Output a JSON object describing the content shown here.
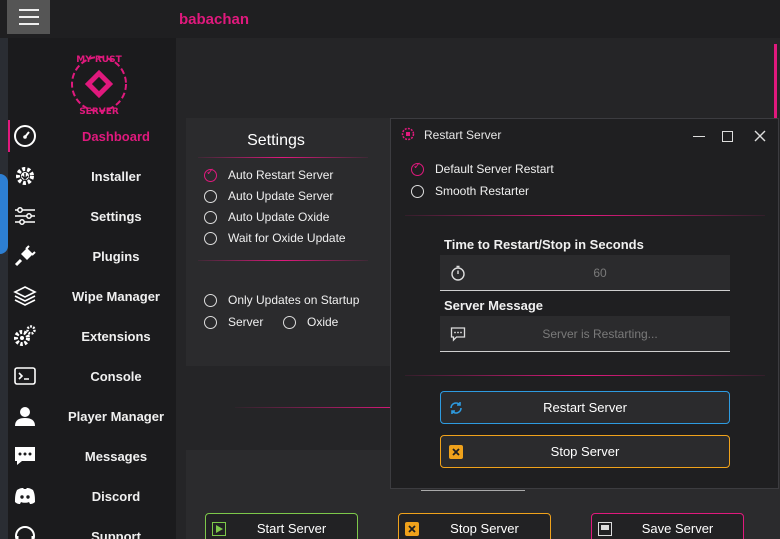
{
  "app": {
    "username": "babachan"
  },
  "sidebar": {
    "items": [
      {
        "label": "Dashboard",
        "icon": "gauge-icon",
        "active": true
      },
      {
        "label": "Installer",
        "icon": "gear-download-icon"
      },
      {
        "label": "Settings",
        "icon": "sliders-icon"
      },
      {
        "label": "Plugins",
        "icon": "plug-icon"
      },
      {
        "label": "Wipe Manager",
        "icon": "layers-icon"
      },
      {
        "label": "Extensions",
        "icon": "gears-icon"
      },
      {
        "label": "Console",
        "icon": "terminal-icon"
      },
      {
        "label": "Player Manager",
        "icon": "user-icon"
      },
      {
        "label": "Messages",
        "icon": "chat-icon"
      },
      {
        "label": "Discord",
        "icon": "discord-icon"
      },
      {
        "label": "Support",
        "icon": "support-icon"
      }
    ]
  },
  "settings": {
    "title": "Settings",
    "options": [
      {
        "label": "Auto Restart Server",
        "checked": true
      },
      {
        "label": "Auto Update Server",
        "checked": false
      },
      {
        "label": "Auto Update Oxide",
        "checked": false
      },
      {
        "label": "Wait for Oxide Update",
        "checked": false
      }
    ],
    "startup_label": "Only Updates on Startup",
    "server_label": "Server",
    "oxide_label": "Oxide"
  },
  "bottom": {
    "start_label": "Start Server",
    "stop_label": "Stop Server",
    "save_label": "Save Server"
  },
  "dialog": {
    "title": "Restart Server",
    "mode_default": "Default Server Restart",
    "mode_smooth": "Smooth Restarter",
    "time_label": "Time to Restart/Stop in Seconds",
    "time_value": "60",
    "message_label": "Server Message",
    "message_placeholder": "Server is Restarting...",
    "restart_button": "Restart Server",
    "stop_button": "Stop Server"
  },
  "colors": {
    "accent": "#e0197d",
    "blue": "#2e9be0",
    "orange": "#f0a21b",
    "green": "#7dc84a"
  }
}
